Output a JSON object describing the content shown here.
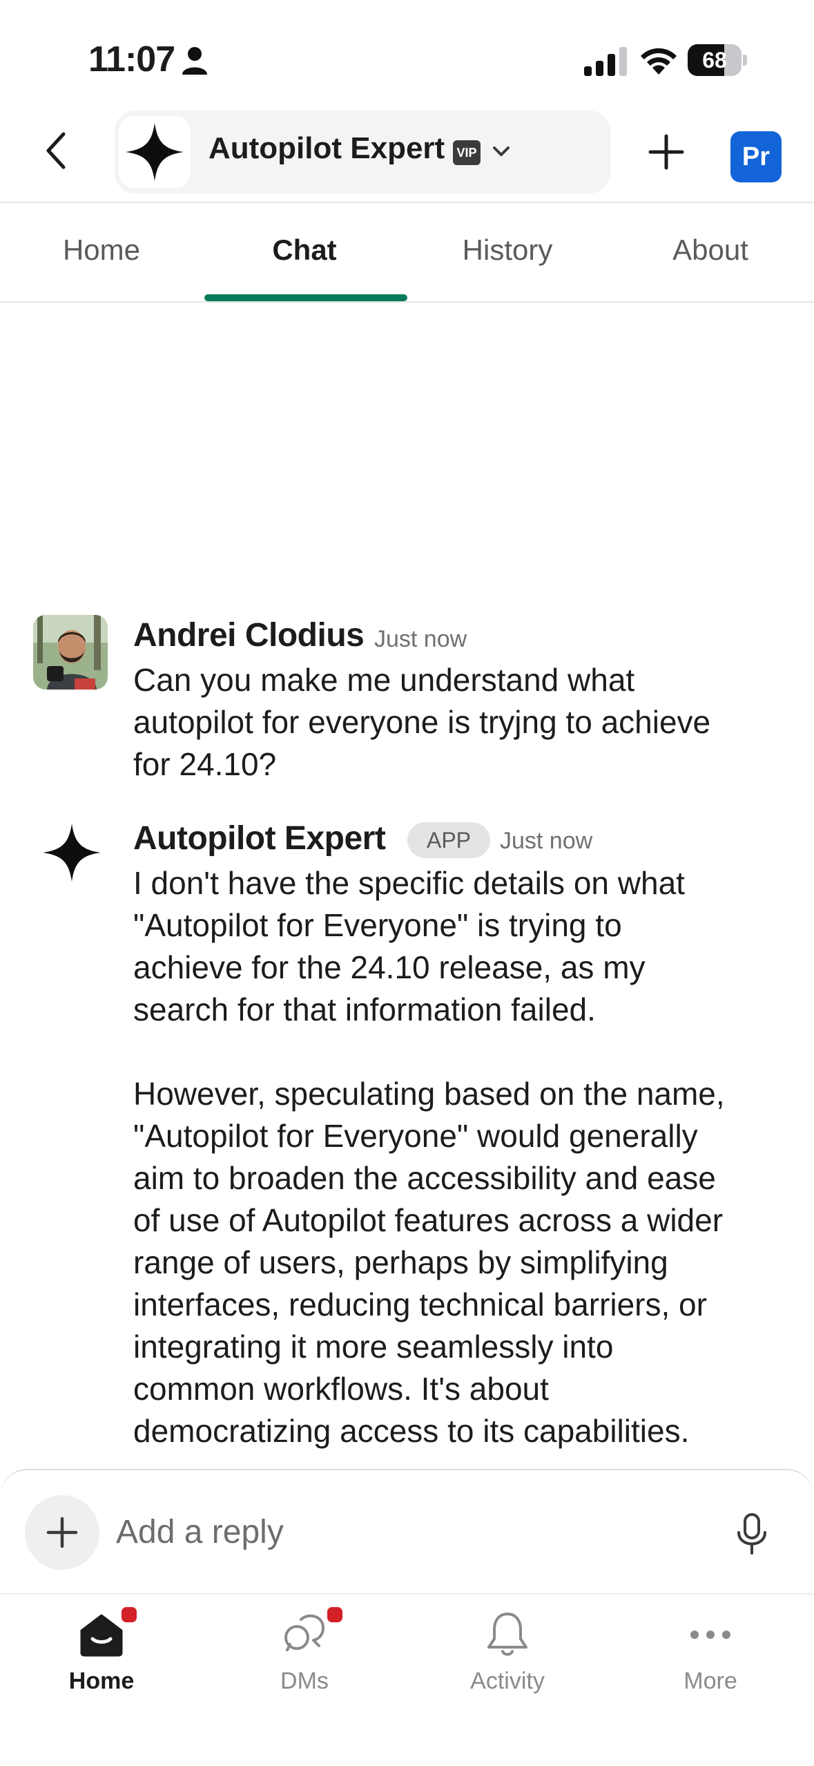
{
  "status_bar": {
    "time": "11:07",
    "battery": "68",
    "battery_level": 0.68,
    "icons": [
      "person-icon",
      "signal-icon",
      "wifi-icon",
      "battery-icon"
    ]
  },
  "header": {
    "channel_name": "Autopilot Expert",
    "vip_label": "VIP",
    "profile_initials": "Pr",
    "icons": [
      "back-icon",
      "sparkle-icon",
      "chevron-down-icon",
      "plus-icon"
    ]
  },
  "tabs": [
    {
      "label": "Home"
    },
    {
      "label": "Chat",
      "active": true
    },
    {
      "label": "History"
    },
    {
      "label": "About"
    }
  ],
  "messages": [
    {
      "sender": "Andrei Clodius",
      "time": "Just now",
      "text": "Can you make me understand what\nautopilot for everyone is tryjng to achieve\nfor 24.10?"
    },
    {
      "sender": "Autopilot Expert",
      "badge": "APP",
      "time": "Just now",
      "text": "I don't have the specific details on what\n\"Autopilot for Everyone\" is trying to\nachieve for the 24.10 release, as my\nsearch for that information failed.\n\nHowever, speculating based on the name,\n\"Autopilot for Everyone\" would generally\naim to broaden the accessibility and ease\nof use of Autopilot features across a wider\nrange of users, perhaps by simplifying\ninterfaces, reducing technical barriers, or\nintegrating it more seamlessly into\ncommon workflows. It's about\ndemocratizing access to its capabilities."
    }
  ],
  "composer": {
    "placeholder": "Add a reply",
    "icons": [
      "plus-icon",
      "microphone-icon"
    ]
  },
  "bottom_nav": [
    {
      "label": "Home",
      "icon": "home-icon",
      "active": true,
      "badge": true
    },
    {
      "label": "DMs",
      "icon": "chat-bubbles-icon",
      "badge": true
    },
    {
      "label": "Activity",
      "icon": "bell-icon"
    },
    {
      "label": "More",
      "icon": "more-dots-icon"
    }
  ],
  "colors": {
    "tab_indicator": "#077a5c",
    "profile_button": "#1264d8",
    "notification_dot": "#d42027"
  }
}
